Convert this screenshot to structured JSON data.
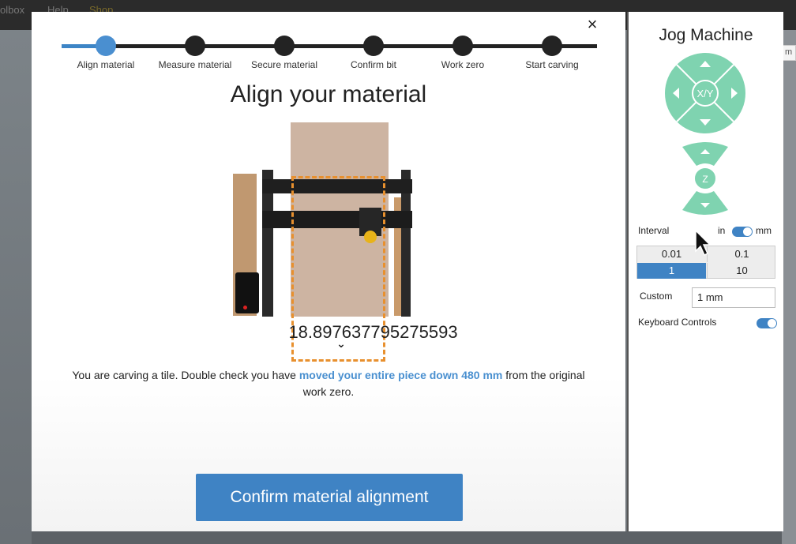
{
  "background_menu": [
    "olbox",
    "Help",
    "Shop"
  ],
  "background_right_text": "m",
  "modal": {
    "close_label": "×",
    "steps": [
      {
        "label": "Align material",
        "active": true
      },
      {
        "label": "Measure material",
        "active": false
      },
      {
        "label": "Secure material",
        "active": false
      },
      {
        "label": "Confirm bit",
        "active": false
      },
      {
        "label": "Work zero",
        "active": false
      },
      {
        "label": "Start carving",
        "active": false
      }
    ],
    "title": "Align your material",
    "measurement_value": "18.897637795275593",
    "instruction_prefix": "You are carving a tile. Double check you have ",
    "instruction_highlight": "moved your entire piece down 480 mm",
    "instruction_suffix": " from the original work zero.",
    "confirm_button": "Confirm material alignment"
  },
  "jog": {
    "title": "Jog Machine",
    "xy_label": "X/Y",
    "z_label": "Z",
    "interval_label": "Interval",
    "unit_in": "in",
    "unit_mm": "mm",
    "unit_selected": "mm",
    "intervals": [
      "0.01",
      "0.1",
      "1",
      "10"
    ],
    "interval_selected": "1",
    "custom_label": "Custom",
    "custom_value": "1 mm",
    "keyboard_label": "Keyboard Controls",
    "keyboard_enabled": true
  },
  "colors": {
    "accent": "#3f83c4",
    "jog_green": "#7fd3b0",
    "dashed_outline": "#e8902e",
    "highlight_text": "#4a90d0"
  }
}
